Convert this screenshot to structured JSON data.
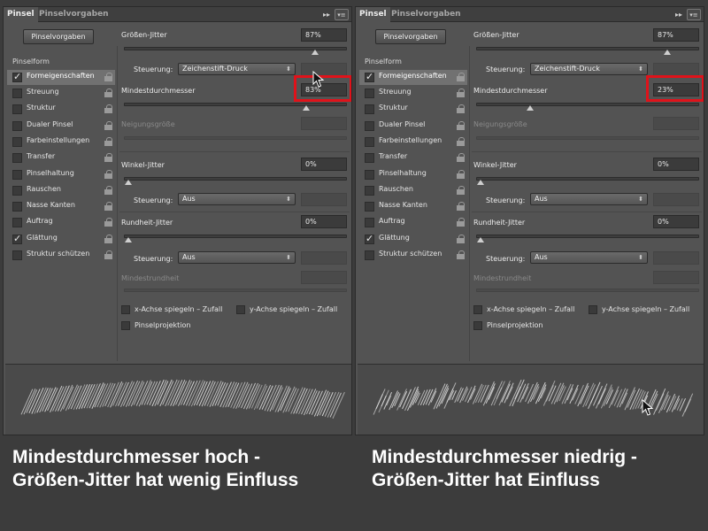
{
  "panels": [
    {
      "tabs": [
        "Pinsel",
        "Pinselvorgaben"
      ],
      "collapse_glyph": "▸▸",
      "menu_glyph": "▾≡",
      "presets_button": "Pinselvorgaben",
      "sidebar_title": "Pinselform",
      "sidebar_items": [
        {
          "label": "Formeigenschaften",
          "checked": true,
          "selected": true
        },
        {
          "label": "Streuung",
          "checked": false
        },
        {
          "label": "Struktur",
          "checked": false
        },
        {
          "label": "Dualer Pinsel",
          "checked": false
        },
        {
          "label": "Farbeinstellungen",
          "checked": false
        },
        {
          "label": "Transfer",
          "checked": false
        },
        {
          "label": "Pinselhaltung",
          "checked": false
        },
        {
          "label": "Rauschen",
          "checked": false
        },
        {
          "label": "Nasse Kanten",
          "checked": false
        },
        {
          "label": "Auftrag",
          "checked": false
        },
        {
          "label": "Glättung",
          "checked": true
        },
        {
          "label": "Struktur schützen",
          "checked": false
        }
      ],
      "size_jitter": {
        "label": "Größen-Jitter",
        "value": "87%",
        "level": 0.87
      },
      "control1": {
        "label": "Steuerung:",
        "value": "Zeichenstift-Druck"
      },
      "min_diameter": {
        "label": "Mindestdurchmesser",
        "value": "83%",
        "level": 0.83
      },
      "tilt_scale": {
        "label": "Neigungsgröße"
      },
      "angle_jitter": {
        "label": "Winkel-Jitter",
        "value": "0%",
        "level": 0
      },
      "control2": {
        "label": "Steuerung:",
        "value": "Aus"
      },
      "roundness_jitter": {
        "label": "Rundheit-Jitter",
        "value": "0%",
        "level": 0
      },
      "control3": {
        "label": "Steuerung:",
        "value": "Aus"
      },
      "min_roundness": {
        "label": "Mindestrundheit"
      },
      "flip_x": "x-Achse spiegeln – Zufall",
      "flip_y": "y-Achse spiegeln – Zufall",
      "projection": "Pinselprojektion",
      "caption": [
        "Mindestdurchmesser hoch -",
        "Größen-Jitter hat wenig Einfluss"
      ]
    },
    {
      "tabs": [
        "Pinsel",
        "Pinselvorgaben"
      ],
      "collapse_glyph": "▸▸",
      "menu_glyph": "▾≡",
      "presets_button": "Pinselvorgaben",
      "sidebar_title": "Pinselform",
      "sidebar_items": [
        {
          "label": "Formeigenschaften",
          "checked": true,
          "selected": true
        },
        {
          "label": "Streuung",
          "checked": false
        },
        {
          "label": "Struktur",
          "checked": false
        },
        {
          "label": "Dualer Pinsel",
          "checked": false
        },
        {
          "label": "Farbeinstellungen",
          "checked": false
        },
        {
          "label": "Transfer",
          "checked": false
        },
        {
          "label": "Pinselhaltung",
          "checked": false
        },
        {
          "label": "Rauschen",
          "checked": false
        },
        {
          "label": "Nasse Kanten",
          "checked": false
        },
        {
          "label": "Auftrag",
          "checked": false
        },
        {
          "label": "Glättung",
          "checked": true
        },
        {
          "label": "Struktur schützen",
          "checked": false
        }
      ],
      "size_jitter": {
        "label": "Größen-Jitter",
        "value": "87%",
        "level": 0.87
      },
      "control1": {
        "label": "Steuerung:",
        "value": "Zeichenstift-Druck"
      },
      "min_diameter": {
        "label": "Mindestdurchmesser",
        "value": "23%",
        "level": 0.23
      },
      "tilt_scale": {
        "label": "Neigungsgröße"
      },
      "angle_jitter": {
        "label": "Winkel-Jitter",
        "value": "0%",
        "level": 0
      },
      "control2": {
        "label": "Steuerung:",
        "value": "Aus"
      },
      "roundness_jitter": {
        "label": "Rundheit-Jitter",
        "value": "0%",
        "level": 0
      },
      "control3": {
        "label": "Steuerung:",
        "value": "Aus"
      },
      "min_roundness": {
        "label": "Mindestrundheit"
      },
      "flip_x": "x-Achse spiegeln – Zufall",
      "flip_y": "y-Achse spiegeln – Zufall",
      "projection": "Pinselprojektion",
      "caption": [
        "Mindestdurchmesser niedrig -",
        "Größen-Jitter hat Einfluss"
      ]
    }
  ],
  "colors": {
    "highlight": "#e0121a",
    "panel_bg": "#535353",
    "page_bg": "#3c3c3c"
  }
}
